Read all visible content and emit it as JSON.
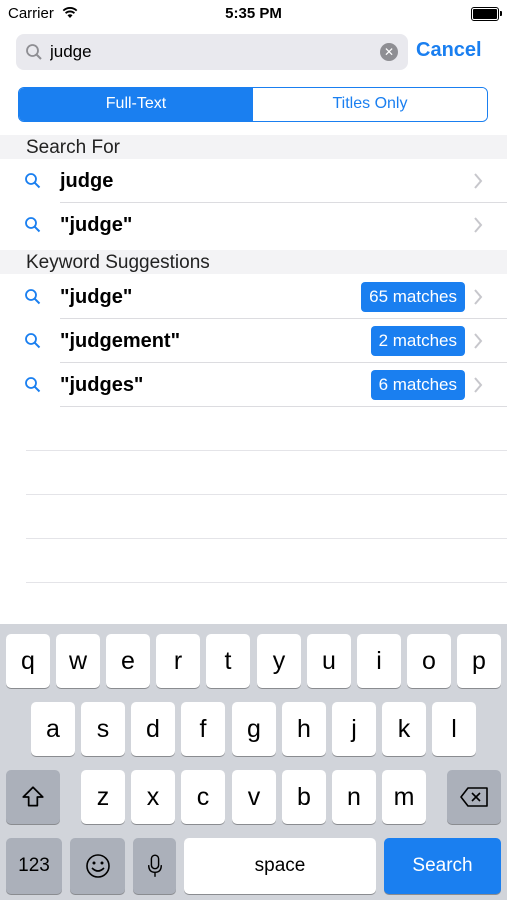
{
  "status": {
    "carrier": "Carrier",
    "time": "5:35 PM"
  },
  "search": {
    "query": "judge",
    "placeholder": "",
    "cancel_label": "Cancel"
  },
  "segments": {
    "full_text": "Full-Text",
    "titles_only": "Titles Only",
    "selected": "Full-Text"
  },
  "search_for": {
    "header": "Search For",
    "items": [
      {
        "label": "judge"
      },
      {
        "label": "\"judge\""
      }
    ]
  },
  "keyword_suggestions": {
    "header": "Keyword Suggestions",
    "items": [
      {
        "label": "\"judge\"",
        "matches": "65 matches"
      },
      {
        "label": "\"judgement\"",
        "matches": "2 matches"
      },
      {
        "label": "\"judges\"",
        "matches": "6 matches"
      }
    ]
  },
  "keyboard": {
    "row1": [
      "q",
      "w",
      "e",
      "r",
      "t",
      "y",
      "u",
      "i",
      "o",
      "p"
    ],
    "row2": [
      "a",
      "s",
      "d",
      "f",
      "g",
      "h",
      "j",
      "k",
      "l"
    ],
    "row3": [
      "z",
      "x",
      "c",
      "v",
      "b",
      "n",
      "m"
    ],
    "numbers_label": "123",
    "space_label": "space",
    "search_label": "Search"
  },
  "colors": {
    "accent": "#1a7ff0",
    "keyboard_bg": "#d1d4da"
  }
}
